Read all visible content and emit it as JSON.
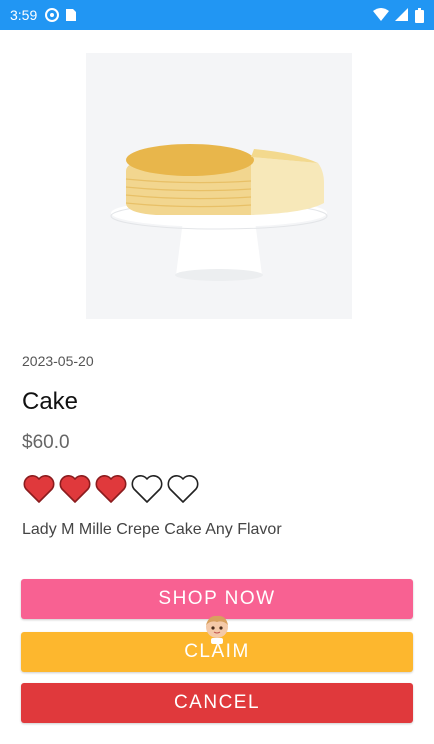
{
  "status_bar": {
    "time": "3:59",
    "background": "#2196f3",
    "left_icons": [
      "settings-icon",
      "sim-card-icon"
    ],
    "right_icons": [
      "wifi-icon",
      "signal-icon",
      "battery-icon"
    ]
  },
  "product": {
    "image_icon": "cake-image",
    "date": "2023-05-20",
    "title": "Cake",
    "price": "$60.0",
    "rating": {
      "value": 3,
      "max": 5,
      "color": "#e0393c"
    },
    "description": "Lady M Mille Crepe Cake Any Flavor"
  },
  "buttons": {
    "shop_now": {
      "label": "SHOP NOW",
      "color": "#f86192"
    },
    "claim": {
      "label": "CLAIM",
      "color": "#fdb72e"
    },
    "cancel": {
      "label": "CANCEL",
      "color": "#e0393c"
    }
  },
  "overlay": {
    "icon": "anime-avatar-sticker"
  }
}
